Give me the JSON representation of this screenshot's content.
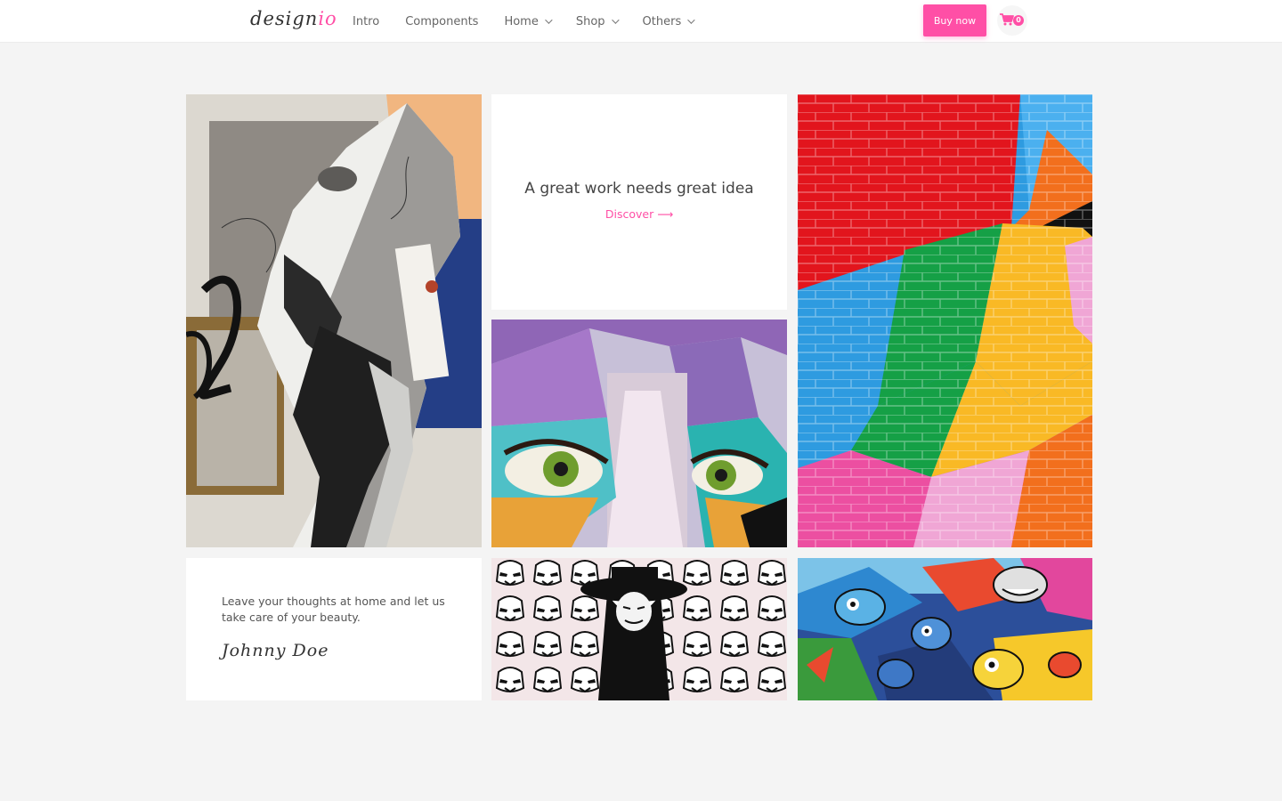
{
  "header": {
    "logo_main": "design",
    "logo_accent": "io",
    "nav": [
      {
        "label": "Intro",
        "has_dropdown": false
      },
      {
        "label": "Components",
        "has_dropdown": false
      },
      {
        "label": "Home",
        "has_dropdown": true
      },
      {
        "label": "Shop",
        "has_dropdown": true
      },
      {
        "label": "Others",
        "has_dropdown": true
      }
    ],
    "buy_label": "Buy now",
    "cart_count": "0",
    "cart_icon": "cart-icon"
  },
  "colors": {
    "accent": "#ff4fa6",
    "background": "#f4f4f4",
    "card": "#ffffff"
  },
  "gallery": {
    "promo": {
      "title": "A great work needs great idea",
      "link_label": "Discover",
      "link_arrow": "⟶"
    },
    "testimonial": {
      "text": "Leave your thoughts at home and let us take care of your beauty.",
      "signature": "Johnny Doe"
    },
    "images": [
      {
        "name": "mural-face-profile"
      },
      {
        "name": "mural-colorful-eyes"
      },
      {
        "name": "colorful-brick-wall"
      },
      {
        "name": "stormtrooper-wall"
      },
      {
        "name": "cartoon-graffiti"
      }
    ]
  }
}
